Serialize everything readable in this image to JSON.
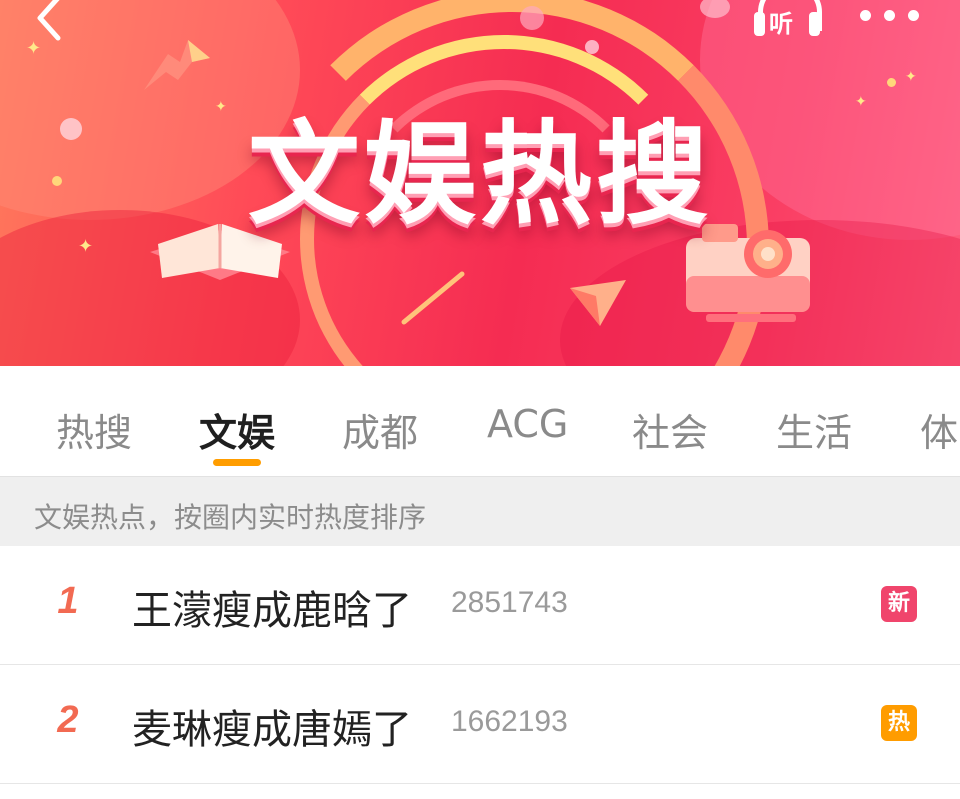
{
  "header": {
    "banner_title": "文娱热搜",
    "listen_label": "听"
  },
  "icons": {
    "back": "chevron-left-icon",
    "listen": "headphones-icon",
    "more": "more-dots-icon"
  },
  "tabs": [
    {
      "label": "热搜",
      "active": false
    },
    {
      "label": "文娱",
      "active": true
    },
    {
      "label": "成都",
      "active": false
    },
    {
      "label": "ACG",
      "active": false
    },
    {
      "label": "社会",
      "active": false
    },
    {
      "label": "生活",
      "active": false
    },
    {
      "label": "体",
      "active": false
    }
  ],
  "subtitle": "文娱热点，按圈内实时热度排序",
  "items": [
    {
      "rank": "1",
      "title": "王濛瘦成鹿晗了",
      "count": "2851743",
      "tag": "新",
      "tag_color": "#f0456c"
    },
    {
      "rank": "2",
      "title": "麦琳瘦成唐嫣了",
      "count": "1662193",
      "tag": "热",
      "tag_color": "#ff9c00"
    }
  ],
  "colors": {
    "accent": "#ff9d00",
    "rank": "#f26a52",
    "banner": "#f52c52"
  }
}
